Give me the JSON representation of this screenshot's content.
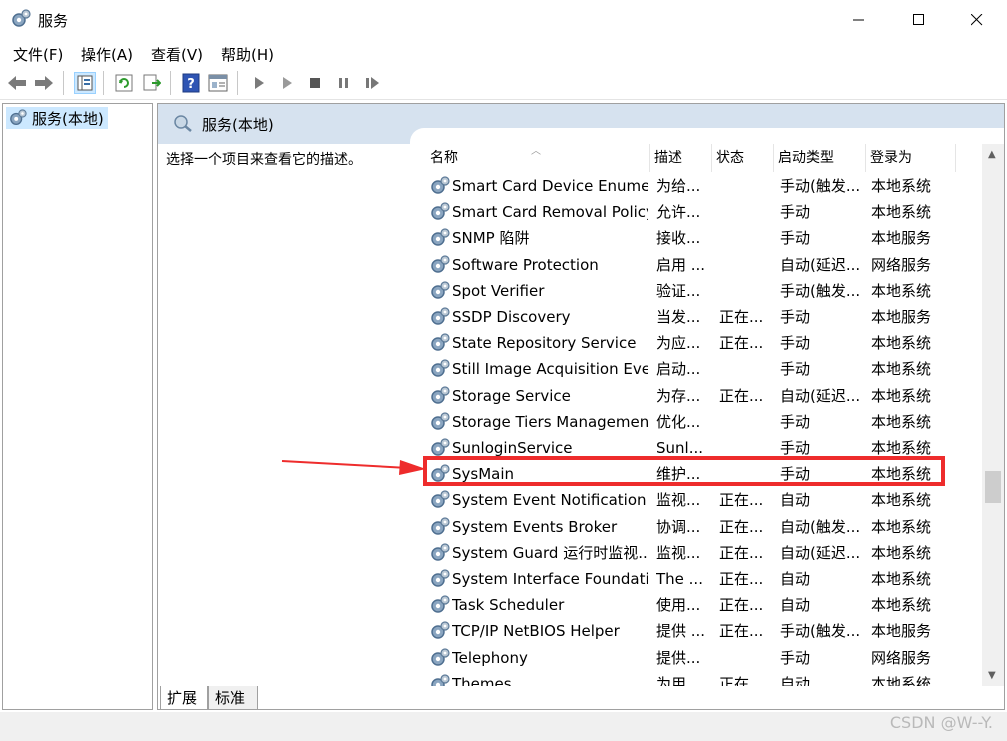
{
  "window": {
    "title": "服务"
  },
  "menu": [
    {
      "label": "文件(F)"
    },
    {
      "label": "操作(A)"
    },
    {
      "label": "查看(V)"
    },
    {
      "label": "帮助(H)"
    }
  ],
  "toolbar": {
    "icons": [
      "back-arrow-icon",
      "forward-arrow-icon",
      "show-tree-icon",
      "refresh-icon",
      "export-list-icon",
      "help-icon",
      "properties-icon",
      "start-icon",
      "start-paused-icon",
      "stop-icon",
      "pause-icon",
      "resume-icon"
    ]
  },
  "tree": {
    "item": "服务(本地)"
  },
  "pane": {
    "title": "服务(本地)",
    "description": "选择一个项目来查看它的描述。"
  },
  "columns": [
    "名称",
    "描述",
    "状态",
    "启动类型",
    "登录为"
  ],
  "rows": [
    {
      "name": "Smart Card Device Enumer...",
      "desc": "为给...",
      "status": "",
      "start": "手动(触发...",
      "logon": "本地系统"
    },
    {
      "name": "Smart Card Removal Policy",
      "desc": "允许...",
      "status": "",
      "start": "手动",
      "logon": "本地系统"
    },
    {
      "name": "SNMP 陷阱",
      "desc": "接收...",
      "status": "",
      "start": "手动",
      "logon": "本地服务"
    },
    {
      "name": "Software Protection",
      "desc": "启用 ...",
      "status": "",
      "start": "自动(延迟...",
      "logon": "网络服务"
    },
    {
      "name": "Spot Verifier",
      "desc": "验证...",
      "status": "",
      "start": "手动(触发...",
      "logon": "本地系统"
    },
    {
      "name": "SSDP Discovery",
      "desc": "当发...",
      "status": "正在...",
      "start": "手动",
      "logon": "本地服务"
    },
    {
      "name": "State Repository Service",
      "desc": "为应...",
      "status": "正在...",
      "start": "手动",
      "logon": "本地系统"
    },
    {
      "name": "Still Image Acquisition Eve...",
      "desc": "启动...",
      "status": "",
      "start": "手动",
      "logon": "本地系统"
    },
    {
      "name": "Storage Service",
      "desc": "为存...",
      "status": "正在...",
      "start": "自动(延迟...",
      "logon": "本地系统"
    },
    {
      "name": "Storage Tiers Management",
      "desc": "优化...",
      "status": "",
      "start": "手动",
      "logon": "本地系统"
    },
    {
      "name": "SunloginService",
      "desc": "Sunl...",
      "status": "",
      "start": "手动",
      "logon": "本地系统"
    },
    {
      "name": "SysMain",
      "desc": "维护...",
      "status": "",
      "start": "手动",
      "logon": "本地系统"
    },
    {
      "name": "System Event Notification ...",
      "desc": "监视...",
      "status": "正在...",
      "start": "自动",
      "logon": "本地系统"
    },
    {
      "name": "System Events Broker",
      "desc": "协调...",
      "status": "正在...",
      "start": "自动(触发...",
      "logon": "本地系统"
    },
    {
      "name": "System Guard 运行时监视...",
      "desc": "监视...",
      "status": "正在...",
      "start": "自动(延迟...",
      "logon": "本地系统"
    },
    {
      "name": "System Interface Foundati...",
      "desc": "The ...",
      "status": "正在...",
      "start": "自动",
      "logon": "本地系统"
    },
    {
      "name": "Task Scheduler",
      "desc": "使用...",
      "status": "正在...",
      "start": "自动",
      "logon": "本地系统"
    },
    {
      "name": "TCP/IP NetBIOS Helper",
      "desc": "提供 ...",
      "status": "正在...",
      "start": "手动(触发...",
      "logon": "本地服务"
    },
    {
      "name": "Telephony",
      "desc": "提供...",
      "status": "",
      "start": "手动",
      "logon": "网络服务"
    },
    {
      "name": "Themes",
      "desc": "为用...",
      "status": "正在...",
      "start": "自动",
      "logon": "本地系统"
    }
  ],
  "tabs": [
    {
      "label": "扩展"
    },
    {
      "label": "标准"
    }
  ],
  "watermark": "CSDN @W--Y.",
  "colors": {
    "highlight": "#ee2c2c",
    "header": "#d6e2ef",
    "tree_selected": "#cce8ff"
  }
}
